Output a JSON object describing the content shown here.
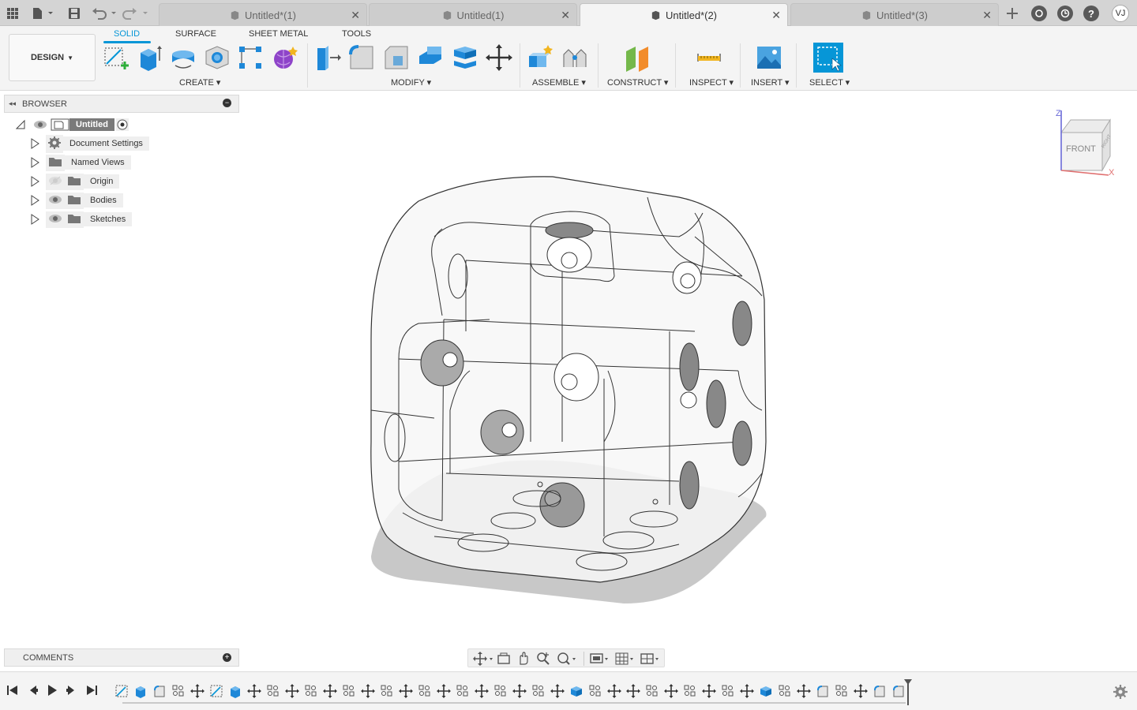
{
  "tabs": [
    {
      "label": "Untitled*(1)",
      "active": false
    },
    {
      "label": "Untitled(1)",
      "active": false
    },
    {
      "label": "Untitled*(2)",
      "active": true
    },
    {
      "label": "Untitled*(3)",
      "active": false
    }
  ],
  "user_initials": "VJ",
  "workspace": {
    "label": "DESIGN"
  },
  "ribbon_tabs": [
    "SOLID",
    "SURFACE",
    "SHEET METAL",
    "TOOLS"
  ],
  "active_ribbon_tab": "SOLID",
  "groups": {
    "create": "CREATE",
    "modify": "MODIFY",
    "assemble": "ASSEMBLE",
    "construct": "CONSTRUCT",
    "inspect": "INSPECT",
    "insert": "INSERT",
    "select": "SELECT"
  },
  "browser": {
    "title": "BROWSER",
    "root": "Untitled",
    "items": [
      {
        "label": "Document Settings",
        "icon": "gear-icon"
      },
      {
        "label": "Named Views",
        "icon": "folder-icon"
      },
      {
        "label": "Origin",
        "icon": "folder-icon"
      },
      {
        "label": "Bodies",
        "icon": "folder-icon"
      },
      {
        "label": "Sketches",
        "icon": "folder-icon"
      }
    ]
  },
  "viewcube": {
    "face": "FRONT",
    "side": "RIGHT",
    "axis_z": "Z",
    "axis_x": "X"
  },
  "comments": {
    "title": "COMMENTS"
  },
  "timeline": {
    "features": [
      "sketch",
      "extrude",
      "fillet",
      "pattern",
      "move",
      "sketch",
      "extrude",
      "move",
      "pattern",
      "move",
      "pattern",
      "move",
      "pattern",
      "move",
      "pattern",
      "move",
      "pattern",
      "move",
      "pattern",
      "move",
      "pattern",
      "move",
      "pattern",
      "move",
      "combine",
      "pattern",
      "move",
      "move",
      "pattern",
      "move",
      "pattern",
      "move",
      "pattern",
      "move",
      "combine",
      "pattern",
      "move",
      "fillet",
      "pattern",
      "move",
      "fillet",
      "fillet",
      "fillet",
      "move",
      "move",
      "fillet"
    ]
  },
  "colors": {
    "accent": "#0696d7",
    "body_blue": "#1e88d8",
    "shadow": "#c8c8c8"
  }
}
